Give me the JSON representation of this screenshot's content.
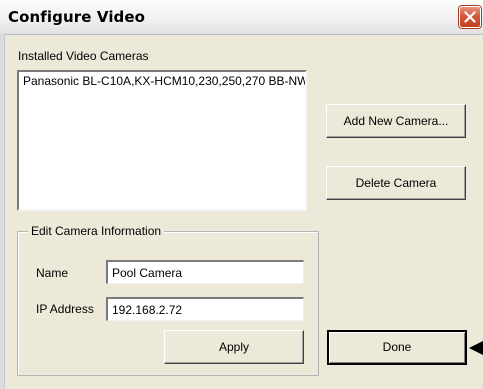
{
  "window": {
    "title": "Configure Video",
    "close_icon": "close-x-icon"
  },
  "cameras": {
    "label": "Installed Video Cameras",
    "items": [
      "Panasonic BL-C10A,KX-HCM10,230,250,270 BB-NW"
    ],
    "add_button": "Add New Camera...",
    "delete_button": "Delete Camera"
  },
  "edit": {
    "legend": "Edit Camera Information",
    "name_label": "Name",
    "name_value": "Pool Camera",
    "ip_label": "IP Address",
    "ip_value": "192.168.2.72",
    "apply_button": "Apply"
  },
  "footer": {
    "done_button": "Done",
    "pointer_icon": "arrow-pointer-icon"
  },
  "colors": {
    "dialog_bg": "#ece9d8",
    "close_button": "#d25a3d"
  }
}
